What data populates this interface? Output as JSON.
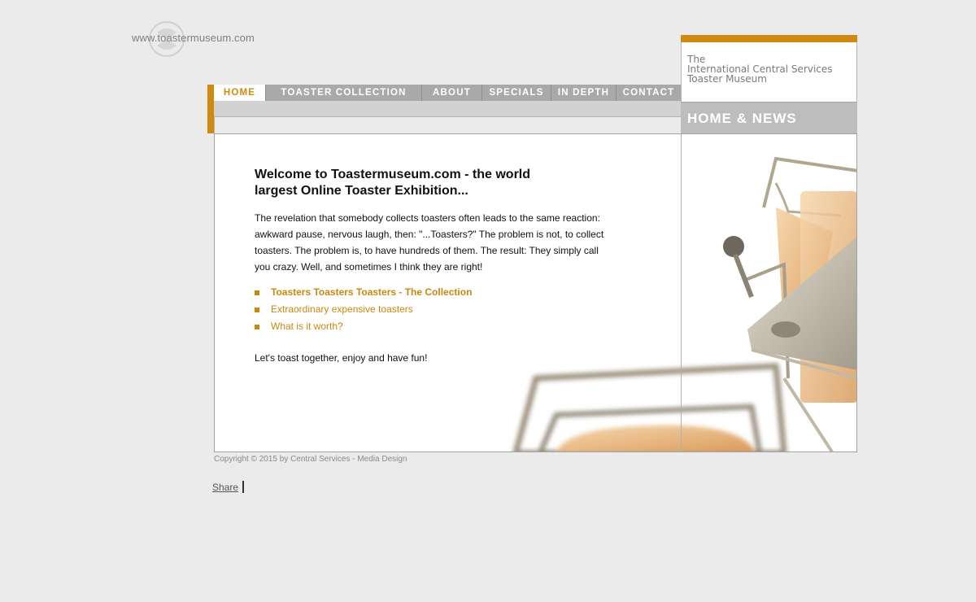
{
  "logo": {
    "url_text": "www.toastermuseum.com"
  },
  "brand": {
    "line1": "The",
    "line2": "International Central Services",
    "line3": "Toaster Museum"
  },
  "section_title": "HOME & NEWS",
  "nav": {
    "items": [
      {
        "label": "HOME"
      },
      {
        "label": "TOASTER COLLECTION"
      },
      {
        "label": "ABOUT"
      },
      {
        "label": "SPECIALS"
      },
      {
        "label": "IN DEPTH"
      },
      {
        "label": "CONTACT"
      }
    ]
  },
  "main": {
    "heading_line1": "Welcome to Toastermuseum.com - the world",
    "heading_line2": "largest Online Toaster Exhibition...",
    "intro": "The revelation that somebody collects toasters often leads to the same reaction: awkward pause, nervous laugh, then: \"...Toasters?\" The problem is not, to collect toasters. The problem is, to have hundreds of them. The result: They simply call you crazy. Well, and sometimes I think they are right!",
    "links": [
      {
        "label": "Toasters Toasters Toasters - The Collection"
      },
      {
        "label": "Extraordinary expensive toasters"
      },
      {
        "label": "What is it worth?"
      }
    ],
    "closing": "Let's toast together, enjoy and have fun!"
  },
  "footer": {
    "copyright": "Copyright © 2015 by Central Services - Media Design",
    "share": "Share"
  },
  "colors": {
    "accent": "#d08a10",
    "link": "#c8870f",
    "nav_bg": "#a9a9a9",
    "page_bg": "#ebebeb"
  }
}
